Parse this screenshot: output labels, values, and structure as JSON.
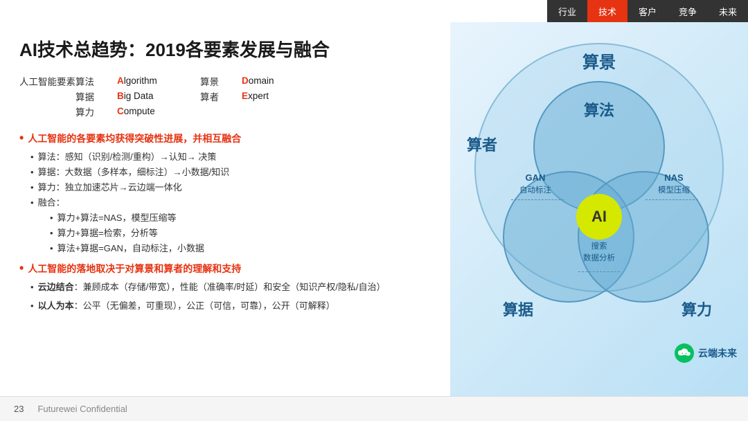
{
  "nav": {
    "items": [
      {
        "label": "行业",
        "active": false
      },
      {
        "label": "技术",
        "active": true
      },
      {
        "label": "客户",
        "active": false
      },
      {
        "label": "竞争",
        "active": false
      },
      {
        "label": "未来",
        "active": false
      }
    ]
  },
  "title": "AI技术总趋势：2019各要素发展与融合",
  "elements": {
    "intro_label": "人工智能要素",
    "rows": [
      {
        "cn1": "算法",
        "en1": "Algorithm",
        "en1_first": "A",
        "en1_rest": "lgorithm",
        "cn2": "算景",
        "en2": "Domain",
        "en2_first": "D",
        "en2_rest": "omain"
      },
      {
        "cn1": "算据",
        "en1": "Big Data",
        "en1_first": "B",
        "en1_rest": "ig Data",
        "cn2": "算者",
        "en2": "Expert",
        "en2_first": "E",
        "en2_rest": "xpert"
      },
      {
        "cn1": "算力",
        "en1": "Compute",
        "en1_first": "C",
        "en1_rest": "ompute",
        "cn2": "",
        "en2": "",
        "en2_first": "",
        "en2_rest": ""
      }
    ]
  },
  "sections": [
    {
      "id": "section1",
      "heading": "人工智能的各要素均获得突破性进展，并相互融合",
      "bullets": [
        "算法：感知（识别/检测/重构）→认知→ 决策",
        "算据：大数据（多样本，细标注）→小数据/知识",
        "算力：独立加速芯片→云边端一体化",
        "融合："
      ],
      "sub_bullets": [
        "算力+算法=NAS，模型压缩等",
        "算力+算据=检索，分析等",
        "算法+算据=GAN，自动标注，小数据"
      ]
    },
    {
      "id": "section2",
      "heading": "人工智能的落地取决于对算景和算者的理解和支持",
      "bullets": [
        "云边结合：兼顾成本（存储/带宽），性能（准确率/时延）和安全（知识产权/隐私/自治）",
        "以人为本：公平（无偏差，可重现），公正（可信，可靠），公开（可解释）"
      ]
    }
  ],
  "diagram": {
    "labels": {
      "suanjing": "算景",
      "suanfa": "算法",
      "suanzhe": "算者",
      "suanshu": "算据",
      "suanli": "算力",
      "ai": "AI",
      "gan": "GAN\n自动标注",
      "nas": "NAS\n模型压缩",
      "search": "搜索\n数据分析"
    }
  },
  "wechat": {
    "brand": "云端未来"
  },
  "footer": {
    "page": "23",
    "company": "Futurewei Confidential"
  }
}
